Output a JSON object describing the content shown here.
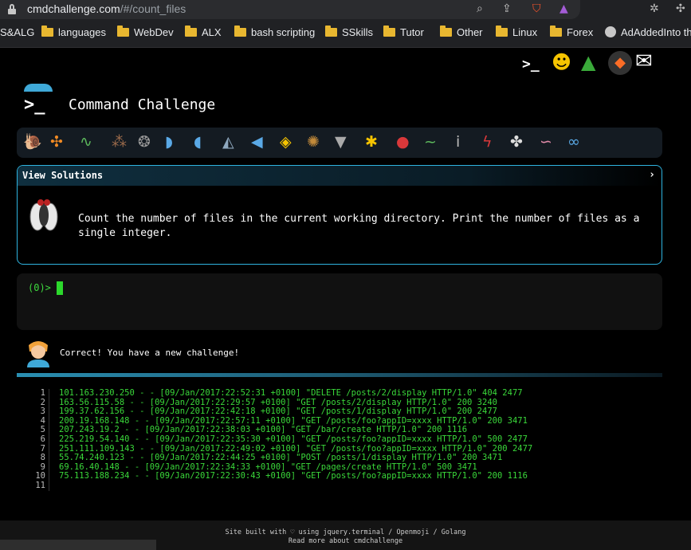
{
  "browser": {
    "url_host": "cmdchallenge.com",
    "url_path": "/#/count_files",
    "icons": [
      "lock-icon",
      "zoom-icon",
      "share-icon",
      "brave-shield-icon",
      "brave-rewards-icon",
      "extensions-icon"
    ]
  },
  "bookmarks": [
    {
      "label": "S&ALG",
      "icon": "none"
    },
    {
      "label": "languages",
      "icon": "folder-icon"
    },
    {
      "label": "WebDev",
      "icon": "folder-icon"
    },
    {
      "label": "ALX",
      "icon": "folder-icon"
    },
    {
      "label": "bash scripting",
      "icon": "folder-icon"
    },
    {
      "label": "SSkills",
      "icon": "folder-icon"
    },
    {
      "label": "Tutor",
      "icon": "folder-icon"
    },
    {
      "label": "Other",
      "icon": "folder-icon"
    },
    {
      "label": "Linux",
      "icon": "folder-icon"
    },
    {
      "label": "Forex",
      "icon": "folder-icon"
    },
    {
      "label": "AdAddedInto th",
      "icon": "globe-icon"
    }
  ],
  "header": {
    "logo_glyph": ">_",
    "title": "Command Challenge",
    "top_icons": [
      "terminal-logo-icon",
      "shushing-face-icon",
      "tree-icon",
      "gitlab-icon",
      "mail-icon"
    ]
  },
  "animal_icons": [
    "snail-icon",
    "butterfly-icon",
    "caterpillar-icon",
    "ant-icon",
    "spider-web-icon",
    "whale-icon",
    "dolphin-icon",
    "shark-icon",
    "fish-icon",
    "tropical-fish-icon",
    "blowfish-icon",
    "wolf-icon",
    "bee-icon",
    "ladybug-icon",
    "worm-icon",
    "mosquito-icon",
    "scorpion-icon",
    "fly-icon",
    "worm-pink-icon",
    "microbe-icon"
  ],
  "task": {
    "header_label": "View Solutions",
    "chevron": "›",
    "icon": "fly-icon",
    "description": "Count the number of files in the current working directory. Print the number of files as a single integer."
  },
  "terminal": {
    "prompt": "(0)>"
  },
  "result": {
    "avatar": "person-avatar-icon",
    "message": "Correct! You have a new challenge!"
  },
  "code_lines": [
    {
      "n": "1",
      "text": "101.163.230.250 - - [09/Jan/2017:22:52:31 +0100] \"DELETE /posts/2/display HTTP/1.0\" 404 2477"
    },
    {
      "n": "2",
      "text": "163.56.115.58 - - [09/Jan/2017:22:29:57 +0100] \"GET /posts/2/display HTTP/1.0\" 200 3240"
    },
    {
      "n": "3",
      "text": "199.37.62.156 - - [09/Jan/2017:22:42:18 +0100] \"GET /posts/1/display HTTP/1.0\" 200 2477"
    },
    {
      "n": "4",
      "text": "200.19.168.148 - - [09/Jan/2017:22:57:11 +0100] \"GET /posts/foo?appID=xxxx HTTP/1.0\" 200 3471"
    },
    {
      "n": "5",
      "text": "207.243.19.2 - - [09/Jan/2017:22:38:03 +0100] \"GET /bar/create HTTP/1.0\" 200 1116"
    },
    {
      "n": "6",
      "text": "225.219.54.140 - - [09/Jan/2017:22:35:30 +0100] \"GET /posts/foo?appID=xxxx HTTP/1.0\" 500 2477"
    },
    {
      "n": "7",
      "text": "251.111.109.143 - - [09/Jan/2017:22:49:02 +0100] \"GET /posts/foo?appID=xxxx HTTP/1.0\" 200 2477"
    },
    {
      "n": "8",
      "text": "55.74.240.123 - - [09/Jan/2017:22:44:25 +0100] \"POST /posts/1/display HTTP/1.0\" 200 3471"
    },
    {
      "n": "9",
      "text": "69.16.40.148 - - [09/Jan/2017:22:34:33 +0100] \"GET /pages/create HTTP/1.0\" 500 3471"
    },
    {
      "n": "10",
      "text": "75.113.188.234 - - [09/Jan/2017:22:30:43 +0100] \"GET /posts/foo?appID=xxxx HTTP/1.0\" 200 1116"
    },
    {
      "n": "11",
      "text": ""
    }
  ],
  "footer": {
    "line1": "Site built with ♡ using jquery.terminal / Openmoji / Golang",
    "line2": "Read more about cmdchallenge"
  },
  "colors": {
    "accent": "#2fb4e0",
    "terminal_green": "#3ad83a",
    "page_bg": "#000000"
  }
}
